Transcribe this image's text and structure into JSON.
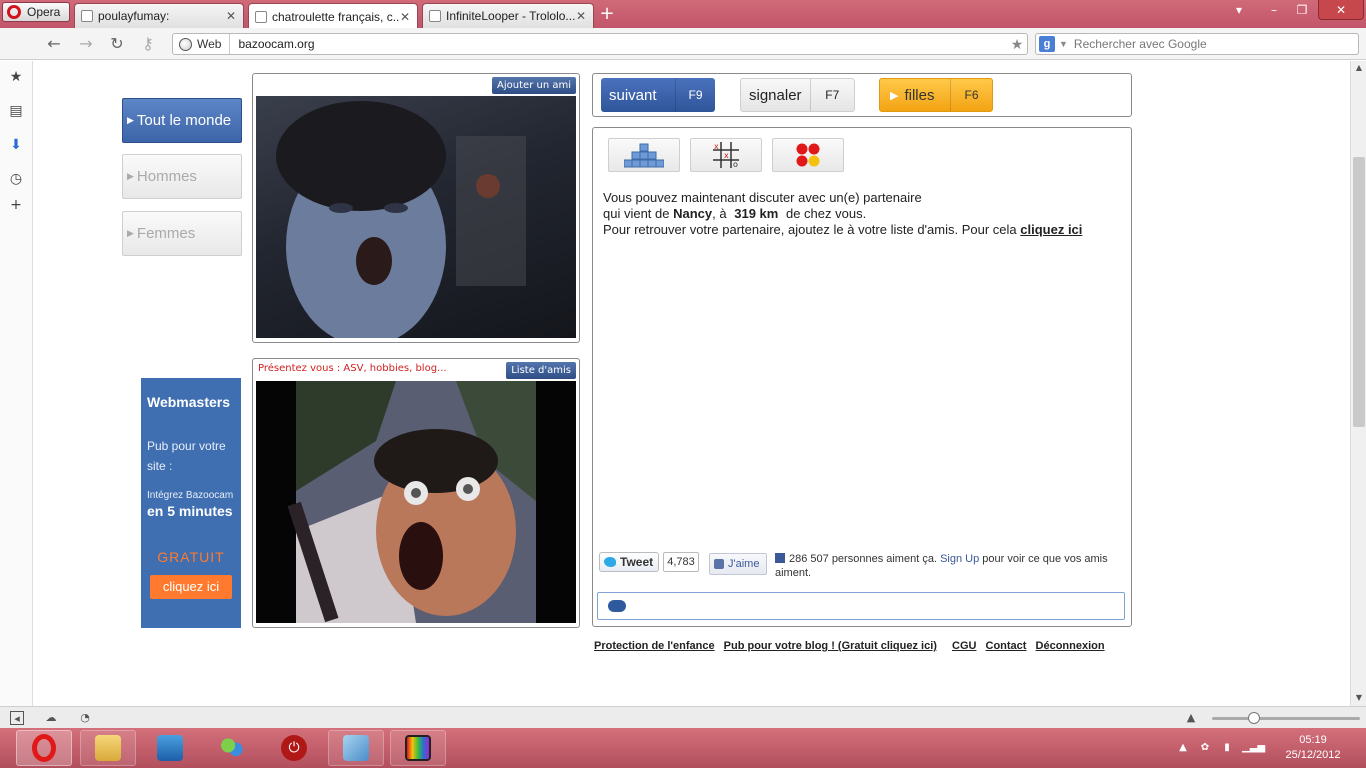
{
  "browser": {
    "menu_label": "Opera",
    "tabs": [
      {
        "label": "poulayfumay:"
      },
      {
        "label": "chatroulette français, c..."
      },
      {
        "label": "InfiniteLooper - Trololo..."
      }
    ],
    "address": {
      "badge": "Web",
      "url": "bazoocam.org"
    },
    "search": {
      "placeholder": "Rechercher avec Google"
    }
  },
  "sidebar": {
    "categories": [
      {
        "label": "Tout le monde",
        "active": true
      },
      {
        "label": "Hommes",
        "active": false
      },
      {
        "label": "Femmes",
        "active": false
      }
    ]
  },
  "ad": {
    "title": "Webmasters",
    "line1": "Pub pour votre",
    "line2": "site :",
    "line3": "Intégrez Bazoocam",
    "line4": "en 5 minutes",
    "free": "GRATUIT",
    "button": "cliquez ici"
  },
  "camera": {
    "partner_button": "Ajouter un ami",
    "self_intro": "Présentez vous : ASV, hobbies, blog...",
    "friends_button": "Liste d'amis"
  },
  "controls": {
    "next": {
      "label": "suivant",
      "key": "F9"
    },
    "report": {
      "label": "signaler",
      "key": "F7"
    },
    "girls": {
      "label": "filles",
      "key": "F6"
    }
  },
  "chat": {
    "line1": "Vous pouvez maintenant discuter avec un(e) partenaire",
    "line2_a": "qui vient de",
    "city": "Nancy",
    "line2_b": ", à",
    "distance": "319 km",
    "line2_c": "de chez vous.",
    "line3": "Pour retrouver votre partenaire, ajoutez le à votre liste d'amis. Pour cela",
    "link": "cliquez ici"
  },
  "social": {
    "tweet_label": "Tweet",
    "tweet_count": "4,783",
    "like_label": "J'aime",
    "fb_count_text": "286 507 personnes aiment ça.",
    "fb_signup": "Sign Up",
    "fb_rest": "pour voir ce que vos amis aiment."
  },
  "footer": {
    "links": [
      "Protection de l'enfance",
      "Pub pour votre blog ! (Gratuit cliquez ici)",
      "CGU",
      "Contact",
      "Déconnexion"
    ]
  },
  "system": {
    "time": "05:19",
    "date": "25/12/2012"
  },
  "colors": {
    "accent_blue": "#3c64a8",
    "girls_orange": "#f3a313",
    "taskbar": "#c2556a"
  }
}
